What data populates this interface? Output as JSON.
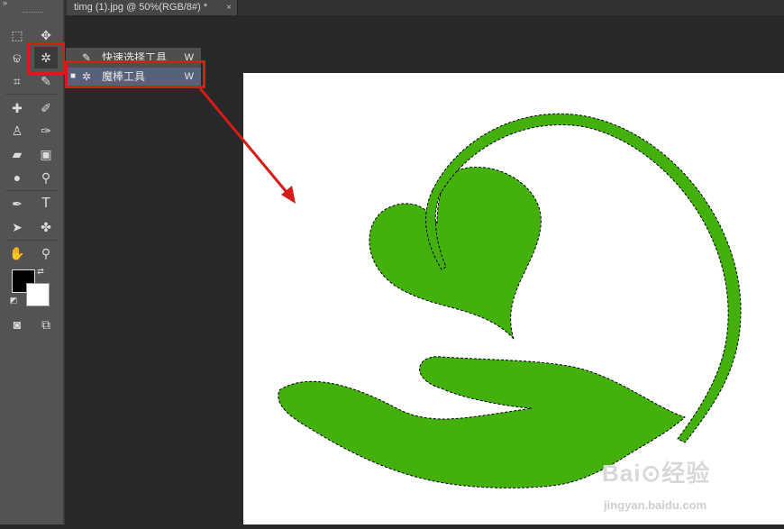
{
  "document_tab": {
    "title": "timg (1).jpg @ 50%(RGB/8#) *",
    "close": "×"
  },
  "toolbar": {
    "collapse_glyph": "»",
    "tools": [
      {
        "name": "rectangular-marquee",
        "glyph": "⬚"
      },
      {
        "name": "move",
        "glyph": "✥"
      },
      {
        "name": "lasso",
        "glyph": "ଢ"
      },
      {
        "name": "magic-wand",
        "glyph": "✲"
      },
      {
        "name": "crop",
        "glyph": "⌗"
      },
      {
        "name": "eyedropper",
        "glyph": "✎"
      },
      {
        "name": "spot-healing",
        "glyph": "✚"
      },
      {
        "name": "brush",
        "glyph": "✐"
      },
      {
        "name": "clone-stamp",
        "glyph": "♙"
      },
      {
        "name": "history-brush",
        "glyph": "✑"
      },
      {
        "name": "eraser",
        "glyph": "▰"
      },
      {
        "name": "gradient",
        "glyph": "▣"
      },
      {
        "name": "blur",
        "glyph": "●"
      },
      {
        "name": "dodge",
        "glyph": "⚲"
      },
      {
        "name": "pen",
        "glyph": "✒"
      },
      {
        "name": "type",
        "glyph": "T"
      },
      {
        "name": "path-selection",
        "glyph": "➤"
      },
      {
        "name": "custom-shape",
        "glyph": "✤"
      },
      {
        "name": "hand",
        "glyph": "✋"
      },
      {
        "name": "zoom",
        "glyph": "⚲"
      },
      {
        "name": "quick-mask",
        "glyph": "◙"
      },
      {
        "name": "screen-mode",
        "glyph": "⧉"
      }
    ],
    "colors": {
      "foreground": "#000000",
      "background": "#ffffff"
    }
  },
  "flyout_menu": {
    "items": [
      {
        "label": "快速选择工具",
        "shortcut": "W",
        "icon": "quick-selection-icon",
        "glyph": "✎",
        "selected": false
      },
      {
        "label": "魔棒工具",
        "shortcut": "W",
        "icon": "magic-wand-icon",
        "glyph": "✲",
        "selected": true,
        "mark": "■"
      }
    ]
  },
  "colors": {
    "accent_red": "#d61b1b",
    "shape_green": "#43b00c",
    "selected_item": "#55627a"
  },
  "watermark": {
    "brand": "Bai⊙经验",
    "url": "jingyan.baidu.com"
  }
}
